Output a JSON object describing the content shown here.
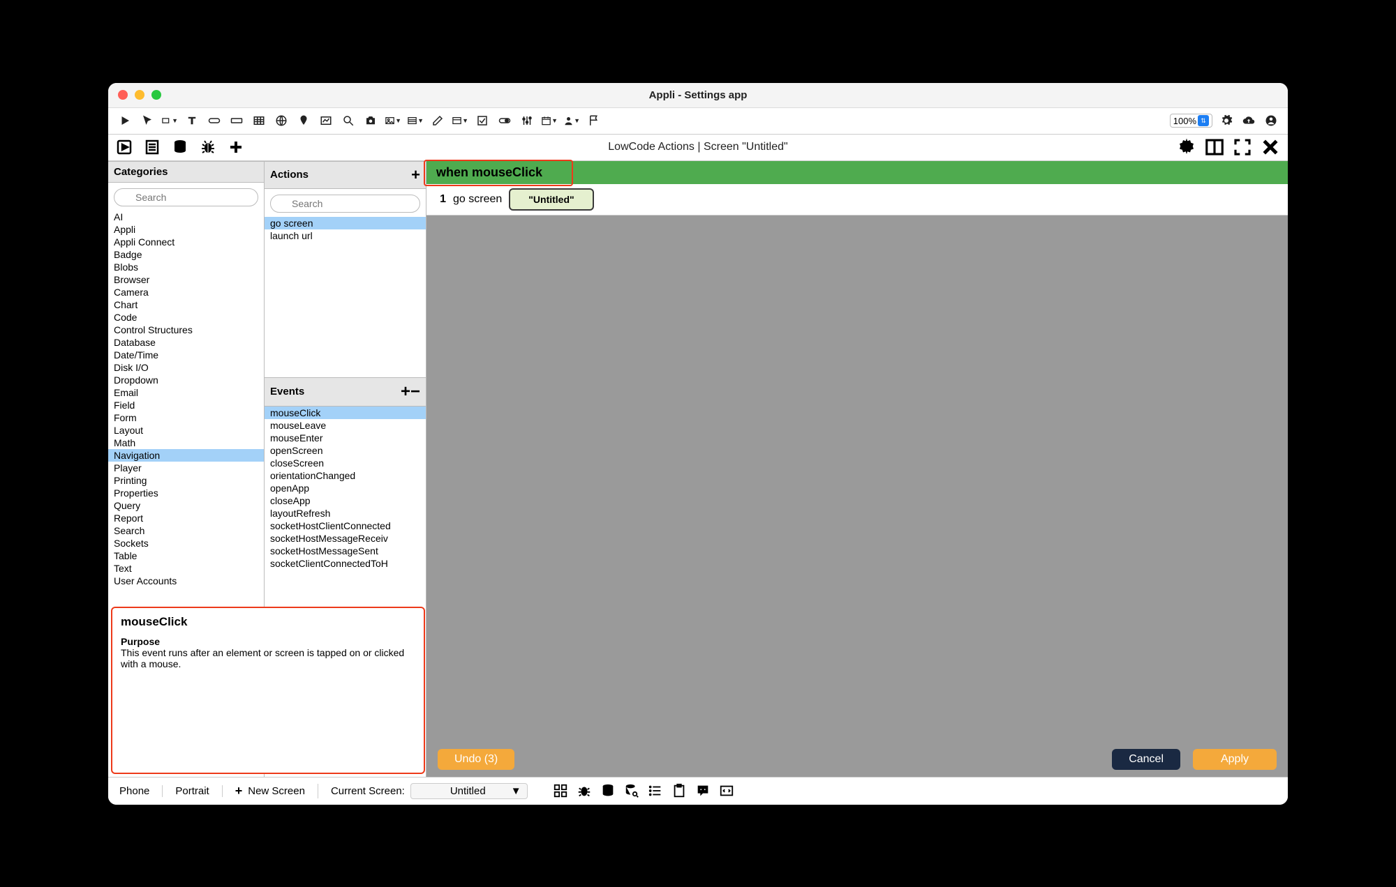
{
  "window_title": "Appli - Settings app",
  "zoom": "100%",
  "secondbar_title": "LowCode Actions | Screen \"Untitled\"",
  "categories": {
    "header": "Categories",
    "search_placeholder": "Search",
    "items": [
      "AI",
      "Appli",
      "Appli Connect",
      "Badge",
      "Blobs",
      "Browser",
      "Camera",
      "Chart",
      "Code",
      "Control Structures",
      "Database",
      "Date/Time",
      "Disk I/O",
      "Dropdown",
      "Email",
      "Field",
      "Form",
      "Layout",
      "Math",
      "Navigation",
      "Player",
      "Printing",
      "Properties",
      "Query",
      "Report",
      "Search",
      "Sockets",
      "Table",
      "Text",
      "User Accounts"
    ],
    "selected": "Navigation"
  },
  "actions": {
    "header": "Actions",
    "search_placeholder": "Search",
    "items": [
      "go screen",
      "launch url"
    ],
    "selected": "go screen"
  },
  "events": {
    "header": "Events",
    "items": [
      "mouseClick",
      "mouseLeave",
      "mouseEnter",
      "openScreen",
      "closeScreen",
      "orientationChanged",
      "openApp",
      "closeApp",
      "layoutRefresh",
      "socketHostClientConnected",
      "socketHostMessageReceiv",
      "socketHostMessageSent",
      "socketClientConnectedToH"
    ],
    "selected": "mouseClick"
  },
  "help": {
    "title": "mouseClick",
    "purpose_label": "Purpose",
    "desc": "This event runs after an element or screen is tapped on or clicked with a mouse."
  },
  "script": {
    "event_label": "when mouseClick",
    "line_num": "1",
    "command": "go screen",
    "param": "\"Untitled\""
  },
  "buttons": {
    "undo": "Undo (3)",
    "cancel": "Cancel",
    "apply": "Apply"
  },
  "statusbar": {
    "device": "Phone",
    "orientation": "Portrait",
    "new_screen": "New Screen",
    "current_screen_label": "Current Screen:",
    "current_screen": "Untitled"
  }
}
